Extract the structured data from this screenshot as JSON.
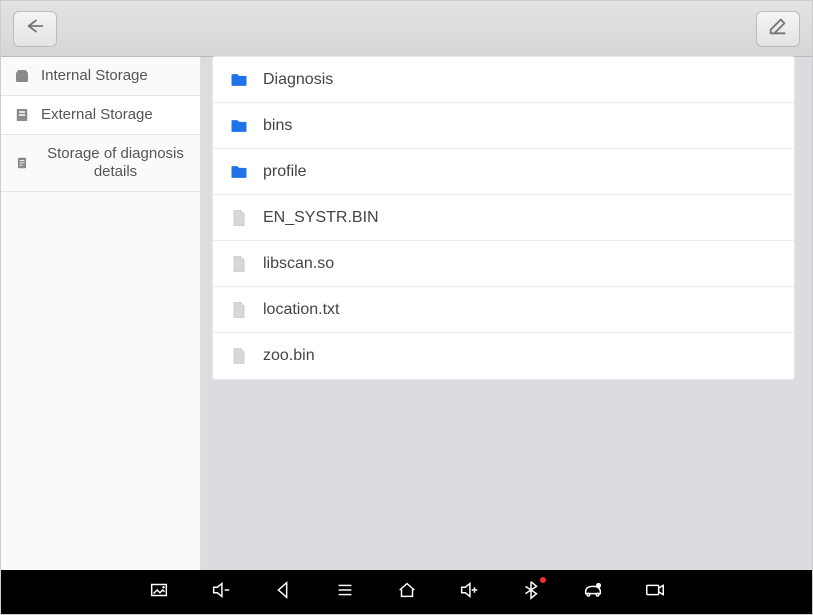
{
  "sidebar": {
    "items": [
      {
        "label": "Internal Storage",
        "icon": "storage-internal-icon"
      },
      {
        "label": "External Storage",
        "icon": "storage-external-icon"
      },
      {
        "label": "Storage of diagnosis details",
        "icon": "storage-diagnosis-icon"
      }
    ]
  },
  "main": {
    "items": [
      {
        "type": "folder",
        "name": "Diagnosis"
      },
      {
        "type": "folder",
        "name": "bins"
      },
      {
        "type": "folder",
        "name": "profile"
      },
      {
        "type": "file",
        "name": "EN_SYSTR.BIN"
      },
      {
        "type": "file",
        "name": "libscan.so"
      },
      {
        "type": "file",
        "name": "location.txt"
      },
      {
        "type": "file",
        "name": "zoo.bin"
      }
    ]
  },
  "topbar": {
    "back": "Back",
    "edit": "Edit"
  },
  "bottombar": {
    "buttons": [
      "screenshot-icon",
      "volume-down-icon",
      "back-nav-icon",
      "menu-icon",
      "home-icon",
      "volume-up-icon",
      "bluetooth-icon",
      "diagnostics-icon",
      "record-icon"
    ]
  }
}
